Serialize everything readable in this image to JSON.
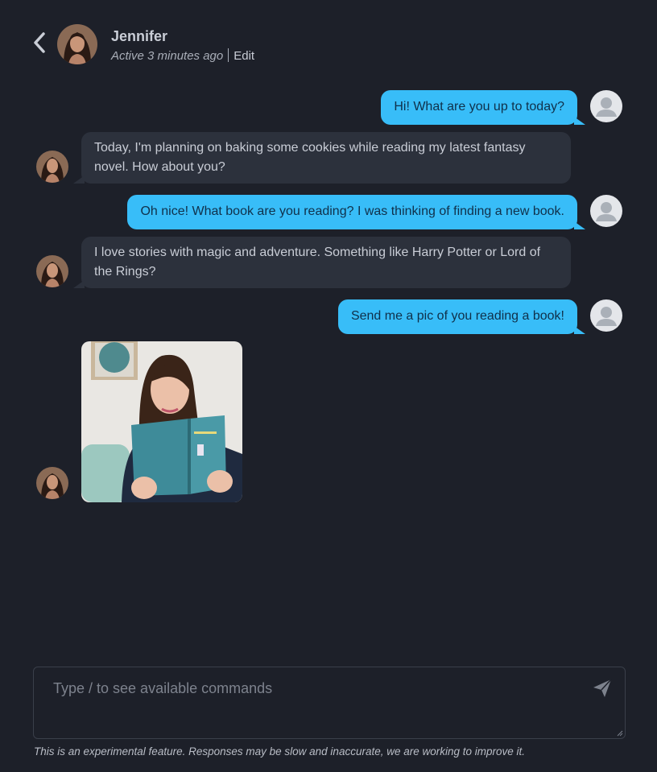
{
  "header": {
    "name": "Jennifer",
    "active_text": "Active 3 minutes ago",
    "edit_label": "Edit"
  },
  "messages": [
    {
      "from": "user",
      "text": "Hi! What are you up to today?"
    },
    {
      "from": "jennifer",
      "text": "Today, I'm planning on baking some cookies while reading my latest fantasy novel. How about you?"
    },
    {
      "from": "user",
      "text": "Oh nice! What book are you reading? I was thinking of finding a new book."
    },
    {
      "from": "jennifer",
      "text": "I love stories with magic and adventure. Something like Harry Potter or Lord of the Rings?"
    },
    {
      "from": "user",
      "text": "Send me a pic of you reading a book!"
    },
    {
      "from": "jennifer",
      "type": "image"
    }
  ],
  "composer": {
    "placeholder": "Type / to see available commands",
    "value": ""
  },
  "disclaimer": "This is an experimental feature. Responses may be slow and inaccurate, we are working to improve it.",
  "colors": {
    "background": "#1d2029",
    "user_bubble": "#38bdf8",
    "bot_bubble": "#2c313c"
  }
}
